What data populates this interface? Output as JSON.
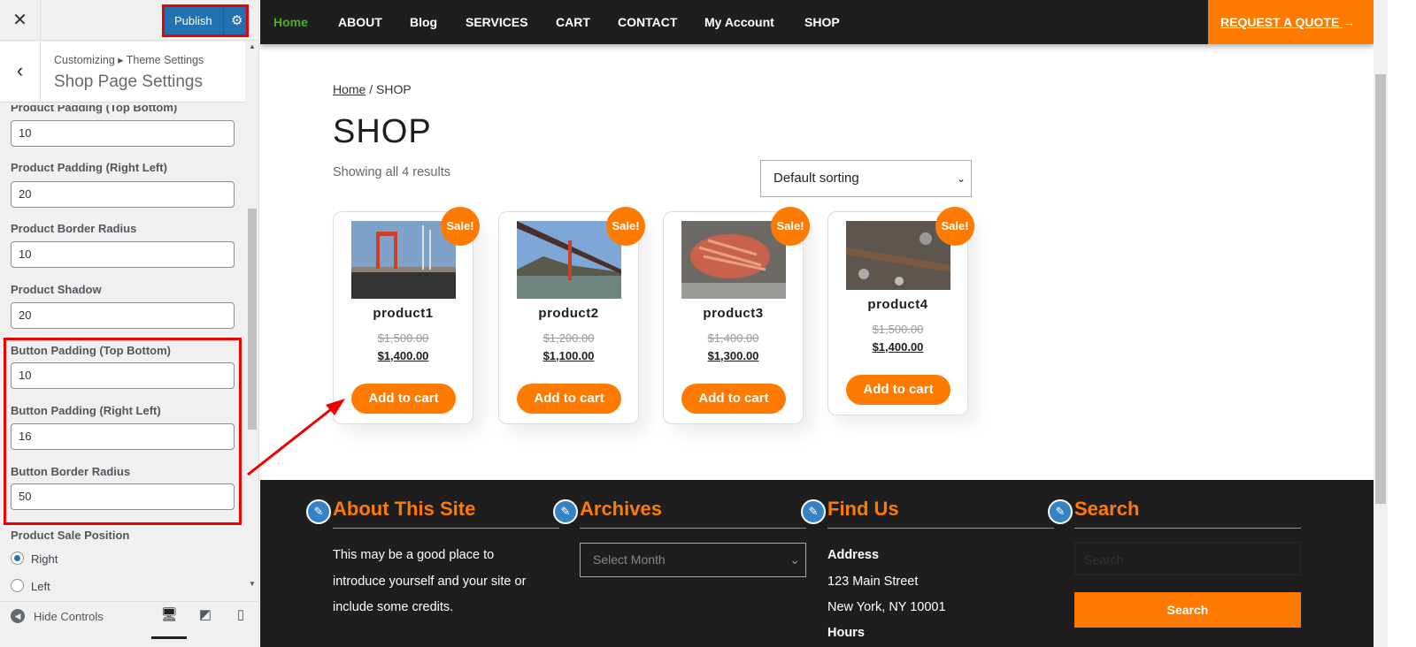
{
  "sidebar": {
    "publish": "Publish",
    "breadcrumb": "Customizing ▸ Theme Settings",
    "title": "Shop Page Settings",
    "fields": [
      {
        "label": "Product Padding (Top Bottom)",
        "value": "10"
      },
      {
        "label": "Product Padding (Right Left)",
        "value": "20"
      },
      {
        "label": "Product Border Radius",
        "value": "10"
      },
      {
        "label": "Product Shadow",
        "value": "20"
      },
      {
        "label": "Button Padding (Top Bottom)",
        "value": "10"
      },
      {
        "label": "Button Padding (Right Left)",
        "value": "16"
      },
      {
        "label": "Button Border Radius",
        "value": "50"
      }
    ],
    "sale_position": {
      "label": "Product Sale Position",
      "options": [
        "Right",
        "Left"
      ],
      "selected": "Right"
    },
    "hide_controls": "Hide Controls"
  },
  "nav": {
    "items": [
      "Home",
      "ABOUT",
      "Blog",
      "SERVICES",
      "CART",
      "CONTACT",
      "My Account",
      "SHOP"
    ],
    "active": "Home",
    "active_color": "#4caf20",
    "quote": "REQUEST A QUOTE"
  },
  "shop": {
    "breadcrumb_home": "Home",
    "breadcrumb_sep": " / SHOP",
    "title": "SHOP",
    "count": "Showing all 4 results",
    "sorting": "Default sorting",
    "products": [
      {
        "name": "product1",
        "old": "$1,500.00",
        "price": "$1,400.00",
        "badge": "Sale!",
        "button": "Add to cart"
      },
      {
        "name": "product2",
        "old": "$1,200.00",
        "price": "$1,100.00",
        "badge": "Sale!",
        "button": "Add to cart"
      },
      {
        "name": "product3",
        "old": "$1,400.00",
        "price": "$1,300.00",
        "badge": "Sale!",
        "button": "Add to cart"
      },
      {
        "name": "product4",
        "old": "$1,500.00",
        "price": "$1,400.00",
        "badge": "Sale!",
        "button": "Add to cart"
      }
    ]
  },
  "footer": {
    "about": {
      "title": "About This Site",
      "lines": [
        "This may be a good place to",
        "introduce yourself and your site or",
        "include some credits."
      ]
    },
    "archives": {
      "title": "Archives",
      "select": "Select Month"
    },
    "find": {
      "title": "Find Us",
      "address_label": "Address",
      "lines": [
        "123 Main Street",
        "New York, NY 10001"
      ],
      "hours_label": "Hours"
    },
    "search": {
      "title": "Search",
      "placeholder": "Search",
      "button": "Search"
    }
  },
  "colors": {
    "accent": "#ff7a00",
    "publish": "#2271b1",
    "highlight": "#ff0000",
    "dark": "#1e1e1e"
  }
}
